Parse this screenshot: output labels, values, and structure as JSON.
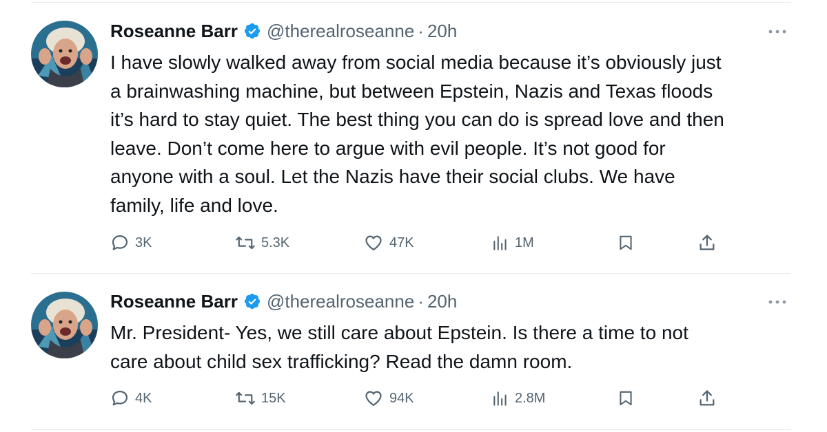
{
  "colors": {
    "text_primary": "#0f1419",
    "text_secondary": "#536471",
    "verified_blue": "#1d9bf0",
    "divider": "#e6ecf0"
  },
  "icons": {
    "verified": "verified-badge-icon",
    "more": "more-horizontal-icon",
    "reply": "reply-bubble-icon",
    "retweet": "retweet-icon",
    "like": "heart-icon",
    "views": "bar-chart-icon",
    "bookmark": "bookmark-icon",
    "share": "share-upload-icon"
  },
  "tweets": [
    {
      "author": {
        "name": "Roseanne Barr",
        "handle": "@therealroseanne",
        "verified": true
      },
      "separator": "·",
      "time": "20h",
      "lines": [
        "I have slowly walked away from social media because it’s obviously just",
        "a brainwashing machine, but between Epstein, Nazis and Texas floods",
        "it’s hard to stay quiet. The best thing you can do is spread love and then",
        "leave. Don’t come here to argue with evil people. It’s not good for",
        "anyone with a soul. Let the Nazis have their social clubs. We have",
        "family, life  and love."
      ],
      "stats": {
        "replies": "3K",
        "retweets": "5.3K",
        "likes": "47K",
        "views": "1M"
      }
    },
    {
      "author": {
        "name": "Roseanne Barr",
        "handle": "@therealroseanne",
        "verified": true
      },
      "separator": "·",
      "time": "20h",
      "lines": [
        "Mr. President- Yes, we still care about Epstein. Is there a time to not",
        "care about child sex trafficking? Read the damn room."
      ],
      "stats": {
        "replies": "4K",
        "retweets": "15K",
        "likes": "94K",
        "views": "2.8M"
      }
    }
  ]
}
